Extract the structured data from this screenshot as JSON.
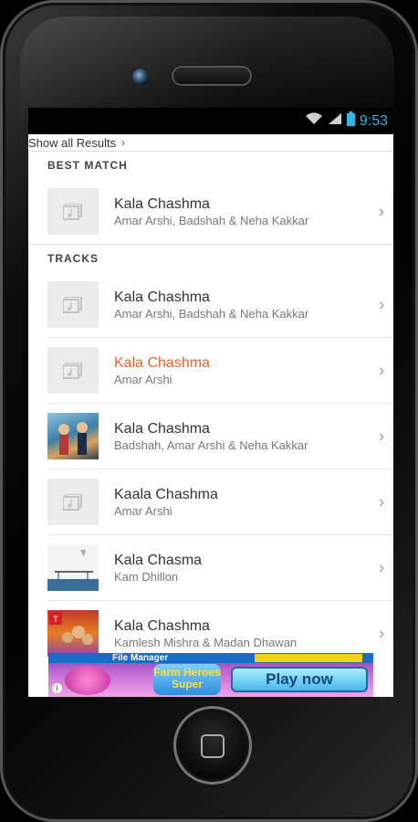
{
  "status_bar": {
    "time": "9:53"
  },
  "show_all": {
    "label": "Show all Results",
    "chevron": "›"
  },
  "best_match": {
    "header": "BEST MATCH",
    "item": {
      "title": "Kala Chashma",
      "artist": "Amar Arshi, Badshah & Neha Kakkar",
      "thumb": "music-placeholder-icon"
    }
  },
  "tracks": {
    "header": "TRACKS",
    "items": [
      {
        "title": "Kala Chashma",
        "artist": "Amar Arshi, Badshah & Neha Kakkar",
        "thumb": "music-placeholder-icon"
      },
      {
        "title": "Kala Chashma",
        "artist": "Amar Arshi",
        "thumb": "music-placeholder-icon",
        "active": true
      },
      {
        "title": "Kala Chashma",
        "artist": "Badshah, Amar Arshi & Neha Kakkar",
        "thumb": "album-art"
      },
      {
        "title": "Kaala Chashma",
        "artist": "Amar Arshi",
        "thumb": "music-placeholder-icon"
      },
      {
        "title": "Kala Chasma",
        "artist": "Kam Dhillon",
        "thumb": "album-art"
      },
      {
        "title": "Kala Chashma",
        "artist": "Kamlesh Mishra & Madan Dhawan",
        "thumb": "album-art"
      }
    ]
  },
  "ad": {
    "top_label": "File Manager",
    "logo": "Farm Heroes Super",
    "cta": "Play now",
    "info": "i"
  },
  "arrow": "›",
  "colors": {
    "active_title": "#e8612c",
    "status_accent": "#33b5e5"
  }
}
